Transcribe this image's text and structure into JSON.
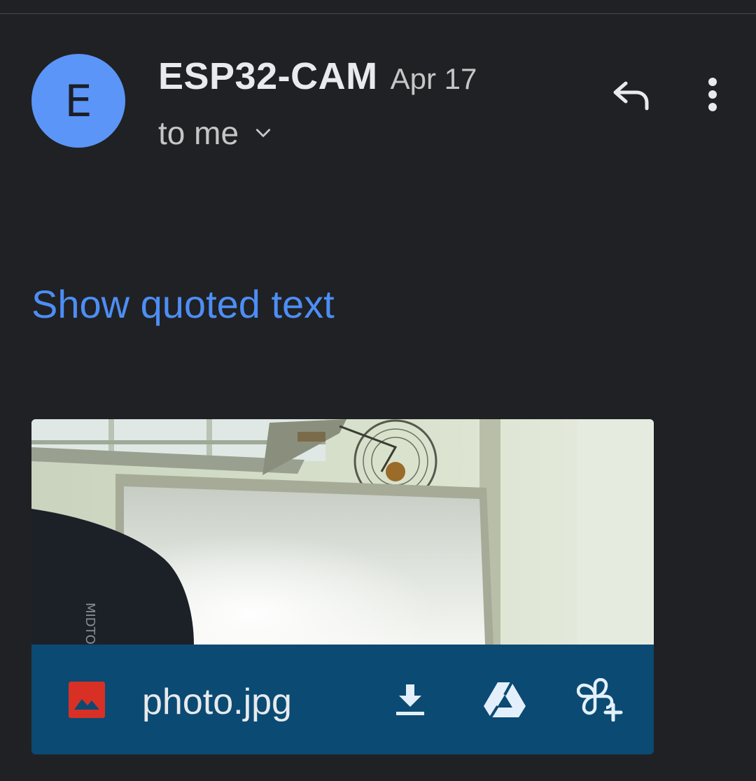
{
  "message": {
    "avatar_initial": "E",
    "sender": "ESP32-CAM",
    "date": "Apr 17",
    "recipient": "to me",
    "show_quoted_text": "Show quoted text"
  },
  "header_actions": {
    "reply_icon": "reply-icon",
    "more_icon": "more-vert-icon"
  },
  "attachment": {
    "file_name": "photo.jpg",
    "file_type_icon": "image-file-icon",
    "actions": [
      "download-icon",
      "drive-icon",
      "photos-add-icon"
    ]
  },
  "colors": {
    "background": "#202124",
    "avatar": "#5b95f7",
    "link": "#4d8ef5",
    "attachment_bar": "#0b4a73",
    "file_icon": "#d93025"
  }
}
